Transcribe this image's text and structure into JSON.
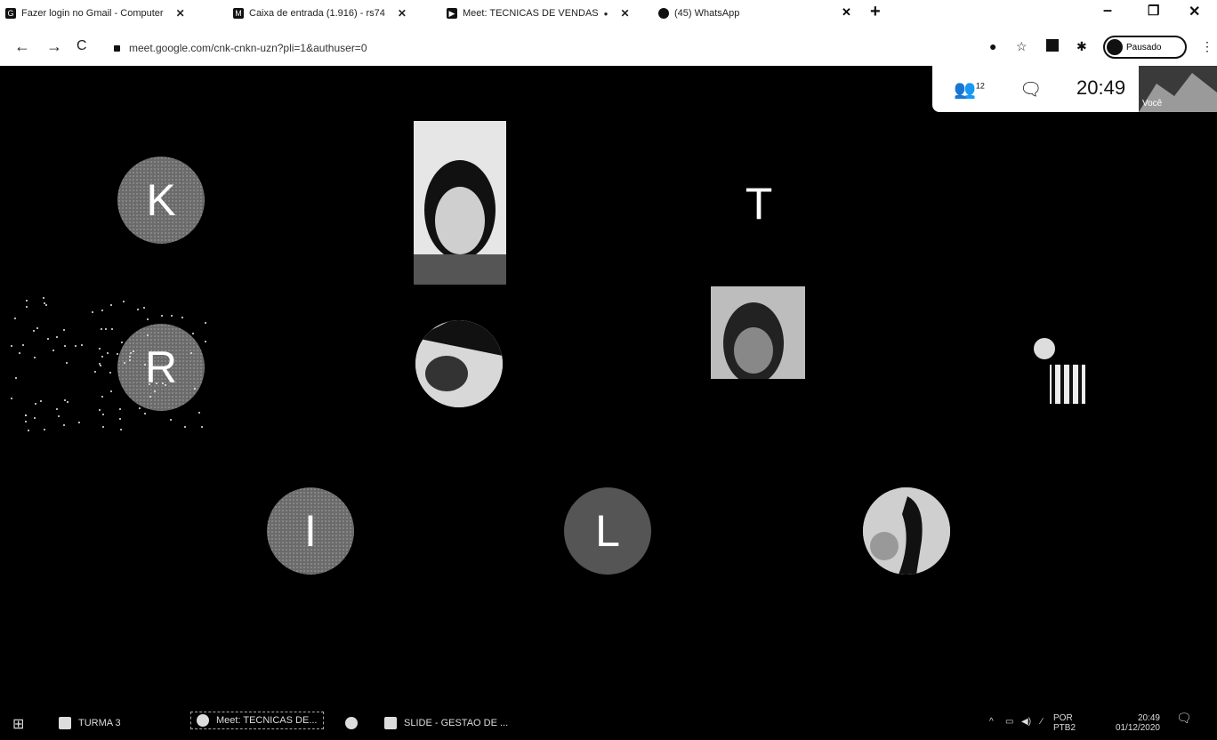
{
  "browser": {
    "tabs": [
      {
        "title": "Fazer login no Gmail - Computer",
        "icon": "google-icon",
        "closable": true
      },
      {
        "title": "Caixa de entrada (1.916) - rs74",
        "icon": "gmail-icon",
        "closable": true
      },
      {
        "title": "Meet: TECNICAS DE VENDAS",
        "icon": "meet-icon",
        "closable": true
      },
      {
        "title": "(45) WhatsApp",
        "icon": "whatsapp-icon",
        "closable": false
      }
    ],
    "new_tab": "+",
    "window_controls": {
      "minimize": "–",
      "maximize": "❐",
      "close": "✕"
    },
    "url": "meet.google.com/cnk-cnkn-uzn?pli=1&authuser=0",
    "profile_label": "Pausado"
  },
  "meet": {
    "participants_count": "12",
    "clock": "20:49",
    "self_label": "Você",
    "tiles": [
      {
        "kind": "initial",
        "initial": "K"
      },
      {
        "kind": "video"
      },
      {
        "kind": "initial",
        "initial": "T"
      },
      {
        "kind": "initial",
        "initial": "R"
      },
      {
        "kind": "avatar"
      },
      {
        "kind": "video"
      },
      {
        "kind": "avatar"
      },
      {
        "kind": "initial",
        "initial": "I"
      },
      {
        "kind": "initial",
        "initial": "L"
      },
      {
        "kind": "avatar"
      }
    ]
  },
  "taskbar": {
    "items": [
      {
        "label": "TURMA 3",
        "icon": "folder-icon"
      },
      {
        "label": "Meet: TECNICAS DE...",
        "icon": "chrome-icon",
        "active": true
      },
      {
        "label": "",
        "icon": "edge-icon"
      },
      {
        "label": "SLIDE - GESTAO DE ...",
        "icon": "powerpoint-icon"
      }
    ],
    "tray_lang": "POR",
    "tray_layout": "PTB2",
    "tray_time": "20:49",
    "tray_date": "01/12/2020"
  }
}
